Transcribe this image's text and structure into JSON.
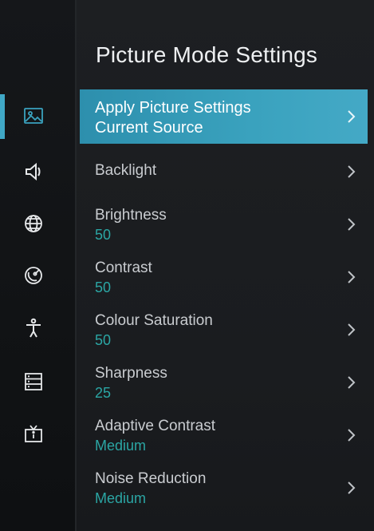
{
  "header": {
    "title": "Picture Mode Settings"
  },
  "sidebar": {
    "icons": [
      {
        "name": "picture-icon"
      },
      {
        "name": "sound-icon"
      },
      {
        "name": "globe-icon"
      },
      {
        "name": "satellite-icon"
      },
      {
        "name": "accessibility-icon"
      },
      {
        "name": "list-icon"
      },
      {
        "name": "tv-icon"
      }
    ]
  },
  "items": [
    {
      "label_line1": "Apply Picture Settings",
      "label_line2": "Current Source"
    },
    {
      "label": "Backlight"
    },
    {
      "label": "Brightness",
      "value": "50"
    },
    {
      "label": "Contrast",
      "value": "50"
    },
    {
      "label": "Colour Saturation",
      "value": "50"
    },
    {
      "label": "Sharpness",
      "value": "25"
    },
    {
      "label": "Adaptive Contrast",
      "value": "Medium"
    },
    {
      "label": "Noise Reduction",
      "value": "Medium"
    }
  ],
  "colors": {
    "accent": "#3aa2be",
    "value": "#2ba6a4",
    "background": "#1b1d20"
  }
}
